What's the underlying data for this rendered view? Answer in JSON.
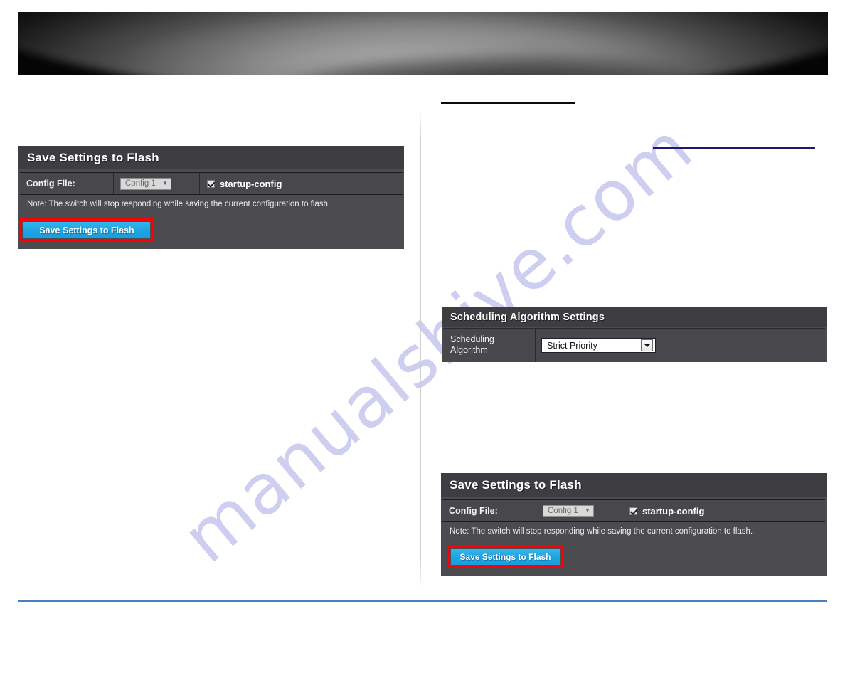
{
  "page": {
    "watermark_text": "manualshive.com",
    "accent_footer_color": "#4a7ebb",
    "highlight_color": "#fb0006",
    "button_color": "#1ba4e2"
  },
  "banner": {
    "name": "page-header-banner"
  },
  "left_column": {
    "save_panel": {
      "title": "Save Settings to Flash",
      "config_file_label": "Config File:",
      "config_file_value": "Config 1",
      "config_file_caret": "▼",
      "startup_config_label": "startup-config",
      "startup_config_checked": true,
      "note": "Note: The switch will stop responding while saving the current configuration to flash.",
      "save_button_label": "Save Settings to Flash"
    }
  },
  "right_column": {
    "scheduling_panel": {
      "title": "Scheduling Algorithm Settings",
      "field_label_line1": "Scheduling",
      "field_label_line2": "Algorithm",
      "selected_option": "Strict Priority"
    },
    "save_panel": {
      "title": "Save Settings to Flash",
      "config_file_label": "Config File:",
      "config_file_value": "Config 1",
      "config_file_caret": "▼",
      "startup_config_label": "startup-config",
      "startup_config_checked": true,
      "note": "Note: The switch will stop responding while saving the current configuration to flash.",
      "save_button_label": "Save Settings to Flash"
    }
  }
}
